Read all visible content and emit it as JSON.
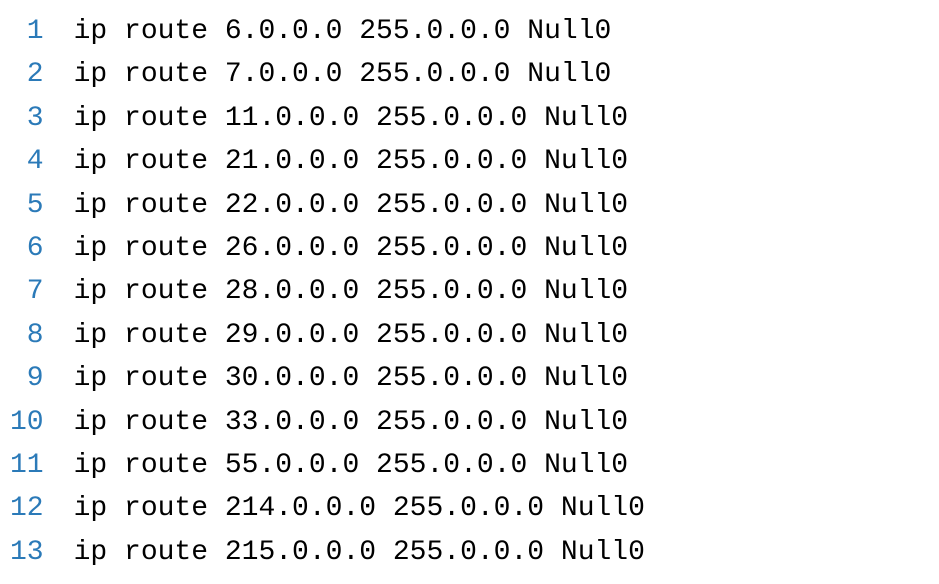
{
  "code": {
    "lines": [
      {
        "n": "1",
        "text": "ip route 6.0.0.0 255.0.0.0 Null0"
      },
      {
        "n": "2",
        "text": "ip route 7.0.0.0 255.0.0.0 Null0"
      },
      {
        "n": "3",
        "text": "ip route 11.0.0.0 255.0.0.0 Null0"
      },
      {
        "n": "4",
        "text": "ip route 21.0.0.0 255.0.0.0 Null0"
      },
      {
        "n": "5",
        "text": "ip route 22.0.0.0 255.0.0.0 Null0"
      },
      {
        "n": "6",
        "text": "ip route 26.0.0.0 255.0.0.0 Null0"
      },
      {
        "n": "7",
        "text": "ip route 28.0.0.0 255.0.0.0 Null0"
      },
      {
        "n": "8",
        "text": "ip route 29.0.0.0 255.0.0.0 Null0"
      },
      {
        "n": "9",
        "text": "ip route 30.0.0.0 255.0.0.0 Null0"
      },
      {
        "n": "10",
        "text": "ip route 33.0.0.0 255.0.0.0 Null0"
      },
      {
        "n": "11",
        "text": "ip route 55.0.0.0 255.0.0.0 Null0"
      },
      {
        "n": "12",
        "text": "ip route 214.0.0.0 255.0.0.0 Null0"
      },
      {
        "n": "13",
        "text": "ip route 215.0.0.0 255.0.0.0 Null0"
      }
    ]
  }
}
